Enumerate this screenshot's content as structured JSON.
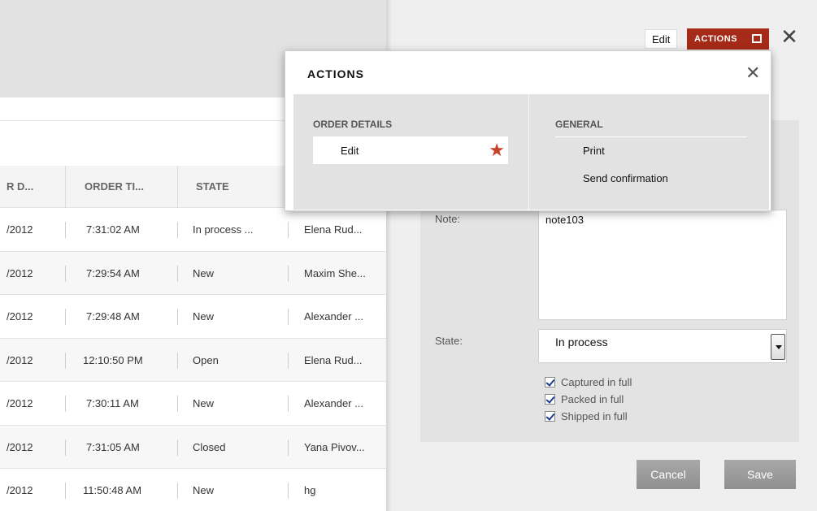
{
  "list": {
    "columns": [
      "R D...",
      "ORDER TI...",
      "STATE"
    ],
    "rows": [
      {
        "date": "/2012",
        "time": "7:31:02 AM",
        "state": "In process ...",
        "customer": "Elena Rud..."
      },
      {
        "date": "/2012",
        "time": "7:29:54 AM",
        "state": "New",
        "customer": "Maxim She..."
      },
      {
        "date": "/2012",
        "time": "7:29:48 AM",
        "state": "New",
        "customer": "Alexander ..."
      },
      {
        "date": "/2012",
        "time": "12:10:50 PM",
        "state": "Open",
        "customer": "Elena Rud..."
      },
      {
        "date": "/2012",
        "time": "7:30:11 AM",
        "state": "New",
        "customer": "Alexander ..."
      },
      {
        "date": "/2012",
        "time": "7:31:05 AM",
        "state": "Closed",
        "customer": "Yana Pivov..."
      },
      {
        "date": "/2012",
        "time": "11:50:48 AM",
        "state": "New",
        "customer": "hg"
      }
    ]
  },
  "detail": {
    "edit_label": "Edit",
    "actions_label": "ACTIONS",
    "close_glyph": "✕",
    "note_label": "Note:",
    "note_value": "note103",
    "state_label": "State:",
    "state_value": "In process",
    "checks": [
      "Captured in full",
      "Packed in full",
      "Shipped in full"
    ],
    "cancel_label": "Cancel",
    "save_label": "Save"
  },
  "popup": {
    "title": "ACTIONS",
    "close_glyph": "✕",
    "order_details_heading": "ORDER DETAILS",
    "order_details_items": [
      "Edit"
    ],
    "general_heading": "GENERAL",
    "general_items": [
      "Print",
      "Send confirmation"
    ],
    "star_glyph": "★",
    "star_color": "#c8402a"
  },
  "colors": {
    "accent": "#a52a17",
    "button_gray": "#999999"
  }
}
